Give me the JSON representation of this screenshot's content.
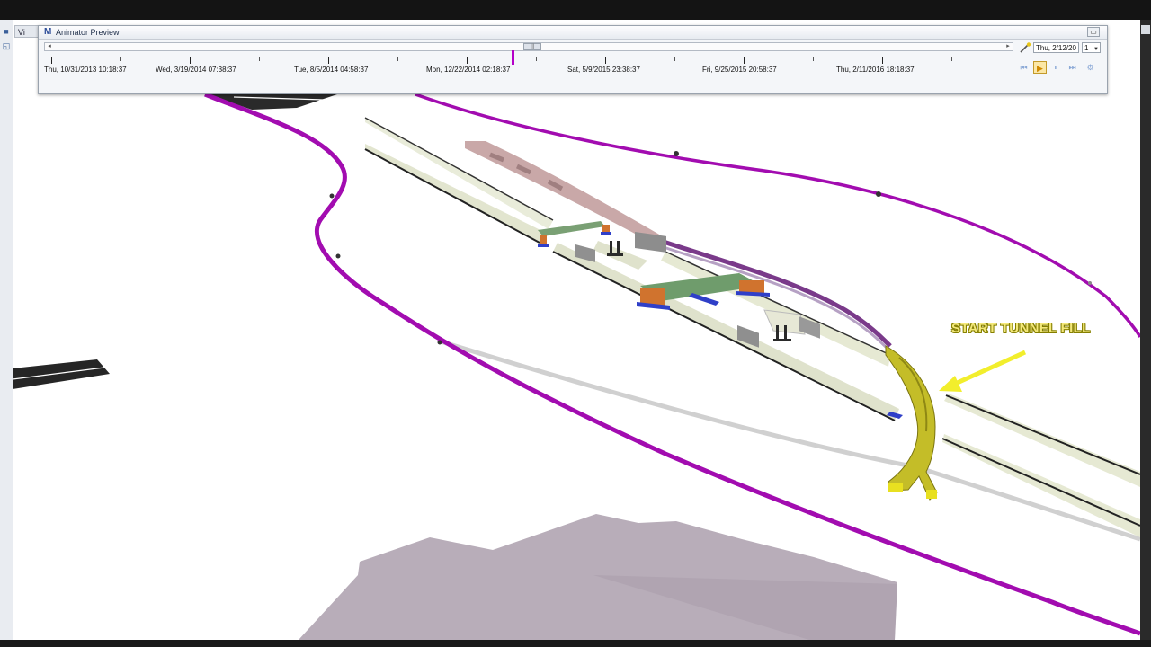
{
  "window": {
    "view_tab_label": "Vi"
  },
  "animator": {
    "title": "Animator Preview",
    "close_label": "▭",
    "current_date": "Thu, 2/12/20",
    "speed": "1",
    "timeline_labels": [
      "Thu, 10/31/2013 10:18:37",
      "Wed, 3/19/2014 07:38:37",
      "Tue, 8/5/2014 04:58:37",
      "Mon, 12/22/2014 02:18:37",
      "Sat, 5/9/2015 23:38:37",
      "Fri, 9/25/2015 20:58:37",
      "Thu, 2/11/2016 18:18:37"
    ],
    "controls": {
      "rewind_icon": "⏮",
      "play_icon": "▶",
      "pause_icon": "⏸",
      "step_icon": "⏭",
      "settings_icon": "⚙"
    }
  },
  "annotation": {
    "text": "START TUNNEL FILL"
  },
  "colors": {
    "alignment": "#a60fb0",
    "tunnel_fill": "#c7c02a",
    "deck_green": "#6f9c6c",
    "pier_orange": "#d0732e",
    "footing_blue": "#2f3fc8",
    "terrain": "#b7abb8",
    "arrow_yellow": "#f2ee2c"
  }
}
